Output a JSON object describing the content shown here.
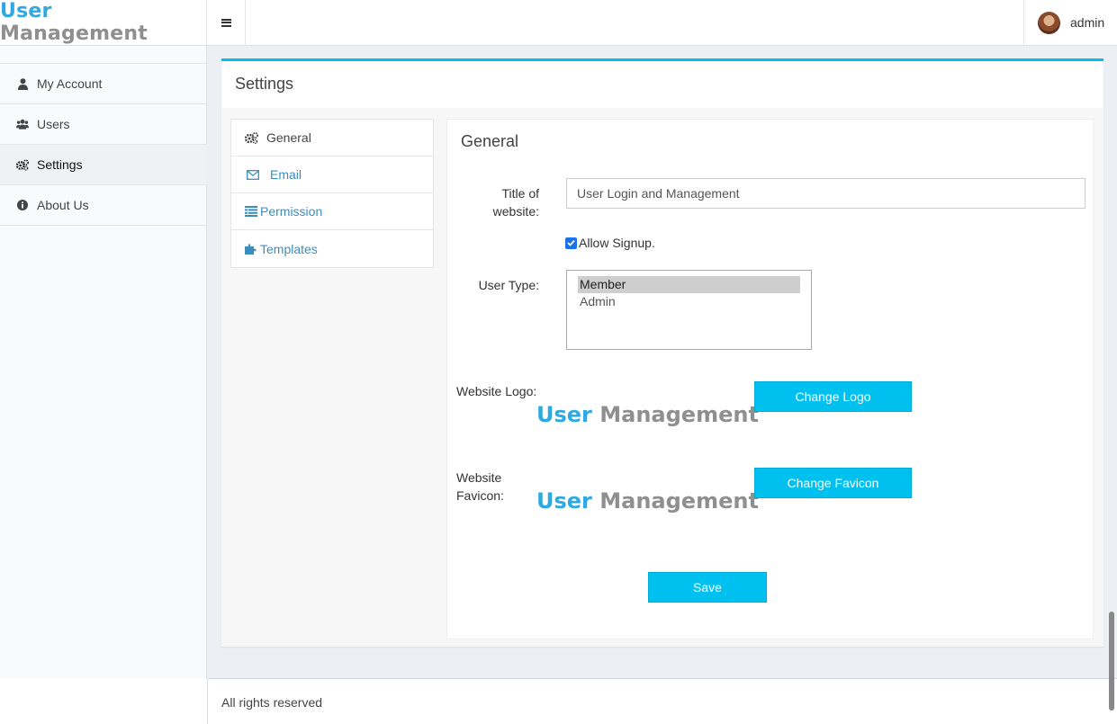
{
  "header": {
    "logo_part1": "User",
    "logo_part2": "Management",
    "user_name": "admin"
  },
  "sidebar": {
    "items": [
      {
        "label": "My Account",
        "icon": "user-icon"
      },
      {
        "label": "Users",
        "icon": "users-icon"
      },
      {
        "label": "Settings",
        "icon": "gears-icon",
        "active": true
      },
      {
        "label": "About Us",
        "icon": "info-circle-icon"
      }
    ]
  },
  "main": {
    "box_title": "Settings",
    "tabs": [
      {
        "label": "General",
        "icon": "gears-icon",
        "active": true
      },
      {
        "label": "Email",
        "icon": "envelope-icon"
      },
      {
        "label": "Permission",
        "icon": "list-icon"
      },
      {
        "label": "Templates",
        "icon": "puzzle-icon"
      }
    ],
    "panel": {
      "title": "General",
      "title_label_line1": "Title of",
      "title_label_line2": "website:",
      "title_value": "User Login and Management",
      "allow_signup_label": "Allow Signup.",
      "allow_signup_checked": true,
      "user_type_label": "User Type:",
      "user_type_options": [
        "Member",
        "Admin"
      ],
      "user_type_selected": "Member",
      "logo_label": "Website Logo:",
      "favicon_label_line1": "Website",
      "favicon_label_line2": "Favicon:",
      "logo_image_text1": "User",
      "logo_image_text2": "Management",
      "change_logo_label": "Change Logo",
      "change_favicon_label": "Change Favicon",
      "save_label": "Save"
    }
  },
  "footer": {
    "text": "All rights reserved"
  },
  "colors": {
    "accent": "#00c0ef",
    "link": "#3c8dbc",
    "logo_blue": "#2fa9e1",
    "logo_gray": "#8f8f8f"
  }
}
